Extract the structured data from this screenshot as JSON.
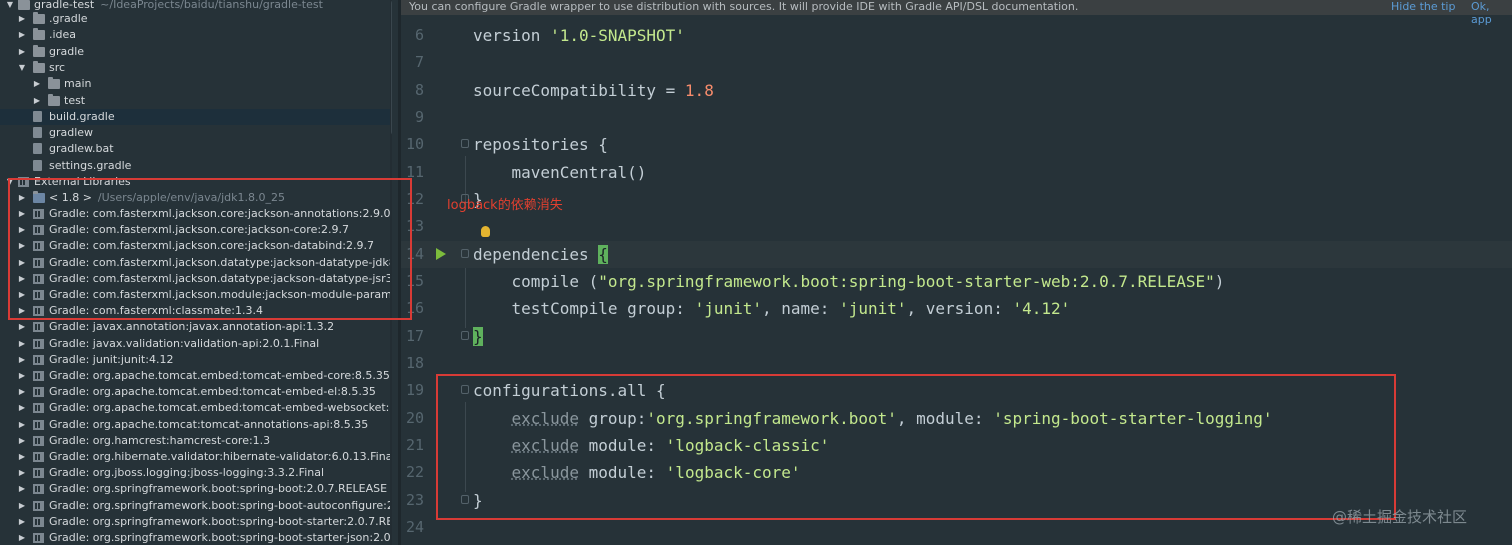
{
  "project": {
    "root_name": "gradle-test",
    "root_path": "~/IdeaProjects/baidu/tianshu/gradle-test",
    "items": [
      {
        "label": ".gradle",
        "kind": "folder",
        "arrow": "▶"
      },
      {
        "label": ".idea",
        "kind": "folder",
        "arrow": "▶"
      },
      {
        "label": "gradle",
        "kind": "folder",
        "arrow": "▶"
      },
      {
        "label": "src",
        "kind": "folder",
        "arrow": "▼"
      },
      {
        "label": "main",
        "kind": "folder",
        "arrow": "▶"
      },
      {
        "label": "test",
        "kind": "folder",
        "arrow": "▶"
      },
      {
        "label": "build.gradle",
        "kind": "file",
        "arrow": ""
      },
      {
        "label": "gradlew",
        "kind": "file",
        "arrow": ""
      },
      {
        "label": "gradlew.bat",
        "kind": "file",
        "arrow": ""
      },
      {
        "label": "settings.gradle",
        "kind": "file",
        "arrow": ""
      }
    ],
    "external_libraries_label": "External Libraries",
    "jdk": {
      "label": "< 1.8 >",
      "path": "/Users/apple/env/java/jdk1.8.0_25"
    },
    "libraries": [
      "Gradle: com.fasterxml.jackson.core:jackson-annotations:2.9.0",
      "Gradle: com.fasterxml.jackson.core:jackson-core:2.9.7",
      "Gradle: com.fasterxml.jackson.core:jackson-databind:2.9.7",
      "Gradle: com.fasterxml.jackson.datatype:jackson-datatype-jdk8",
      "Gradle: com.fasterxml.jackson.datatype:jackson-datatype-jsr3",
      "Gradle: com.fasterxml.jackson.module:jackson-module-param",
      "Gradle: com.fasterxml:classmate:1.3.4",
      "Gradle: javax.annotation:javax.annotation-api:1.3.2",
      "Gradle: javax.validation:validation-api:2.0.1.Final",
      "Gradle: junit:junit:4.12",
      "Gradle: org.apache.tomcat.embed:tomcat-embed-core:8.5.35",
      "Gradle: org.apache.tomcat.embed:tomcat-embed-el:8.5.35",
      "Gradle: org.apache.tomcat.embed:tomcat-embed-websocket:8",
      "Gradle: org.apache.tomcat:tomcat-annotations-api:8.5.35",
      "Gradle: org.hamcrest:hamcrest-core:1.3",
      "Gradle: org.hibernate.validator:hibernate-validator:6.0.13.Final",
      "Gradle: org.jboss.logging:jboss-logging:3.3.2.Final",
      "Gradle: org.springframework.boot:spring-boot:2.0.7.RELEASE",
      "Gradle: org.springframework.boot:spring-boot-autoconfigure:2",
      "Gradle: org.springframework.boot:spring-boot-starter:2.0.7.RE",
      "Gradle: org.springframework.boot:spring-boot-starter-json:2.0"
    ]
  },
  "banner": {
    "message": "You can configure Gradle wrapper to use distribution with sources. It will provide IDE with Gradle API/DSL documentation.",
    "hide_tip": "Hide the tip",
    "ok_apply": "Ok, app"
  },
  "editor": {
    "line_numbers": [
      "6",
      "7",
      "8",
      "9",
      "10",
      "11",
      "12",
      "13",
      "14",
      "15",
      "16",
      "17",
      "18",
      "19",
      "20",
      "21",
      "22",
      "23",
      "24"
    ],
    "version_kw": "version ",
    "version_val": "'1.0-SNAPSHOT'",
    "source_compat": "sourceCompatibility = ",
    "source_compat_val": "1.8",
    "repositories": "repositories {",
    "maven_central": "    mavenCentral()",
    "close_brace": "}",
    "dependencies": "dependencies ",
    "open_brace": "{",
    "compile_kw": "    compile (",
    "compile_val": "\"org.springframework.boot:spring-boot-starter-web:2.0.7.RELEASE\"",
    "compile_close": ")",
    "test_compile_kw": "    testCompile group: ",
    "test_group": "'junit'",
    "test_name_kw": ", name: ",
    "test_name": "'junit'",
    "test_version_kw": ", version: ",
    "test_version": "'4.12'",
    "configurations": "configurations.all {",
    "exclude_kw": "exclude",
    "ex1_group_kw": " group:",
    "ex1_group": "'org.springframework.boot'",
    "ex1_module_kw": ", module: ",
    "ex1_module": "'spring-boot-starter-logging'",
    "ex_module_kw": " module: ",
    "ex2_module": "'logback-classic'",
    "ex3_module": "'logback-core'"
  },
  "annotation_text": "logback的依赖消失",
  "watermark": "@稀土掘金技术社区",
  "colors": {
    "annotation_red": "#d83b36",
    "string": "#c3e88d",
    "number": "#f78c6c"
  }
}
